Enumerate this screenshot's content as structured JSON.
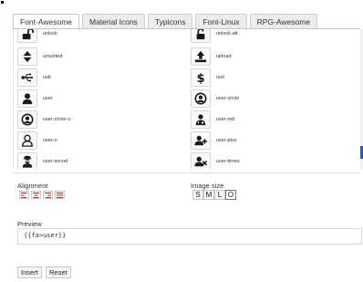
{
  "tabs": [
    {
      "label": "Font-Awesome",
      "active": true
    },
    {
      "label": "Material Icons",
      "active": false
    },
    {
      "label": "Typicons",
      "active": false
    },
    {
      "label": "Font-Linux",
      "active": false
    },
    {
      "label": "RPG-Awesome",
      "active": false
    }
  ],
  "icons": [
    {
      "name": "unlock",
      "icon": "unlock-icon"
    },
    {
      "name": "unlock-alt",
      "icon": "unlock-alt-icon"
    },
    {
      "name": "unsorted",
      "icon": "unsorted-icon"
    },
    {
      "name": "upload",
      "icon": "upload-icon"
    },
    {
      "name": "usb",
      "icon": "usb-icon"
    },
    {
      "name": "usd",
      "icon": "usd-icon"
    },
    {
      "name": "user",
      "icon": "user-icon"
    },
    {
      "name": "user-circle",
      "icon": "user-circle-icon"
    },
    {
      "name": "user-circle-o",
      "icon": "user-circle-o-icon"
    },
    {
      "name": "user-md",
      "icon": "user-md-icon"
    },
    {
      "name": "user-o",
      "icon": "user-o-icon"
    },
    {
      "name": "user-plus",
      "icon": "user-plus-icon"
    },
    {
      "name": "user-secret",
      "icon": "user-secret-icon"
    },
    {
      "name": "user-times",
      "icon": "user-times-icon"
    }
  ],
  "alignment": {
    "label": "Alignment",
    "options": [
      "align-left-icon",
      "align-center-icon",
      "align-right-icon",
      "align-justify-icon"
    ]
  },
  "image_size": {
    "label": "Image size",
    "options": [
      {
        "label": "S",
        "active": false
      },
      {
        "label": "M",
        "active": false
      },
      {
        "label": "L",
        "active": false
      },
      {
        "label": "O",
        "active": true
      }
    ]
  },
  "preview": {
    "label": "Preview",
    "value": "{{fa>user}}"
  },
  "actions": {
    "insert": "Insert",
    "reset": "Reset"
  },
  "colors": {
    "scrollbar_thumb": "#1c5fcf",
    "icon_fill": "#1a1a1a"
  }
}
